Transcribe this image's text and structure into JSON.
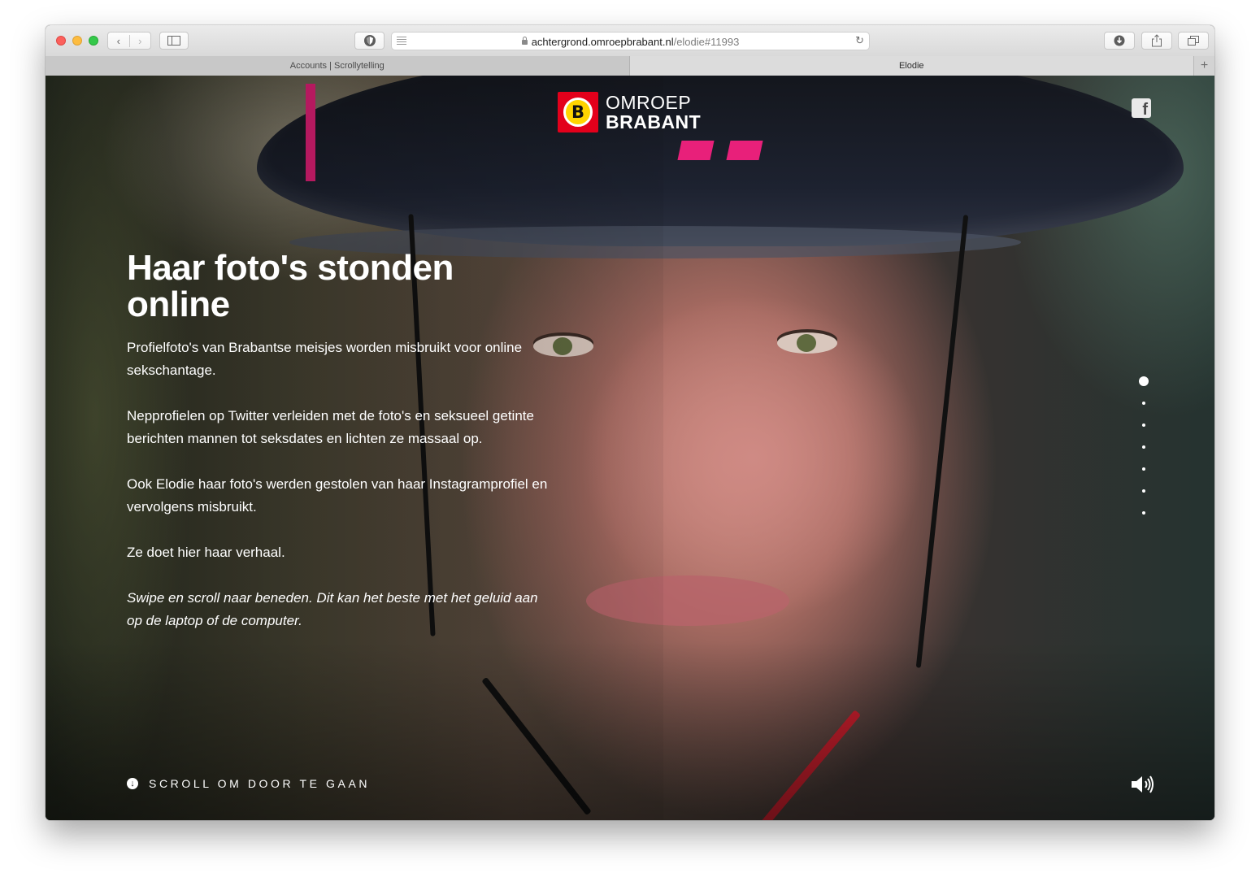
{
  "browser": {
    "url_host": "achtergrond.omroepbrabant.nl",
    "url_path": "/elodie#11993",
    "tabs": [
      {
        "label": "Accounts | Scrollytelling",
        "active": false
      },
      {
        "label": "Elodie",
        "active": true
      }
    ],
    "new_tab_symbol": "+"
  },
  "page": {
    "logo": {
      "badge_letter": "B",
      "line1": "OMROEP",
      "line2": "BRABANT",
      "brand_color": "#e3001b",
      "badge_color": "#ffd400"
    },
    "social": {
      "icon": "facebook-icon",
      "glyph": "f"
    },
    "headline": "Haar foto's stonden online",
    "paragraphs": [
      "Profielfoto's van Brabantse meisjes worden misbruikt voor online sekschantage.",
      "Nepprofielen op Twitter verleiden met de foto's en seksueel getinte berichten mannen tot seksdates en lichten ze massaal op.",
      "Ook Elodie haar foto's werden gestolen van haar Instagramprofiel en vervolgens misbruikt.",
      "Ze doet hier haar verhaal."
    ],
    "instruction": "Swipe en scroll naar beneden. Dit kan het beste met het geluid aan op de laptop of de computer.",
    "scroll_cta": "SCROLL OM DOOR TE GAAN",
    "section_dots": {
      "count": 7,
      "active_index": 0
    },
    "sound_icon": "speaker-icon"
  }
}
